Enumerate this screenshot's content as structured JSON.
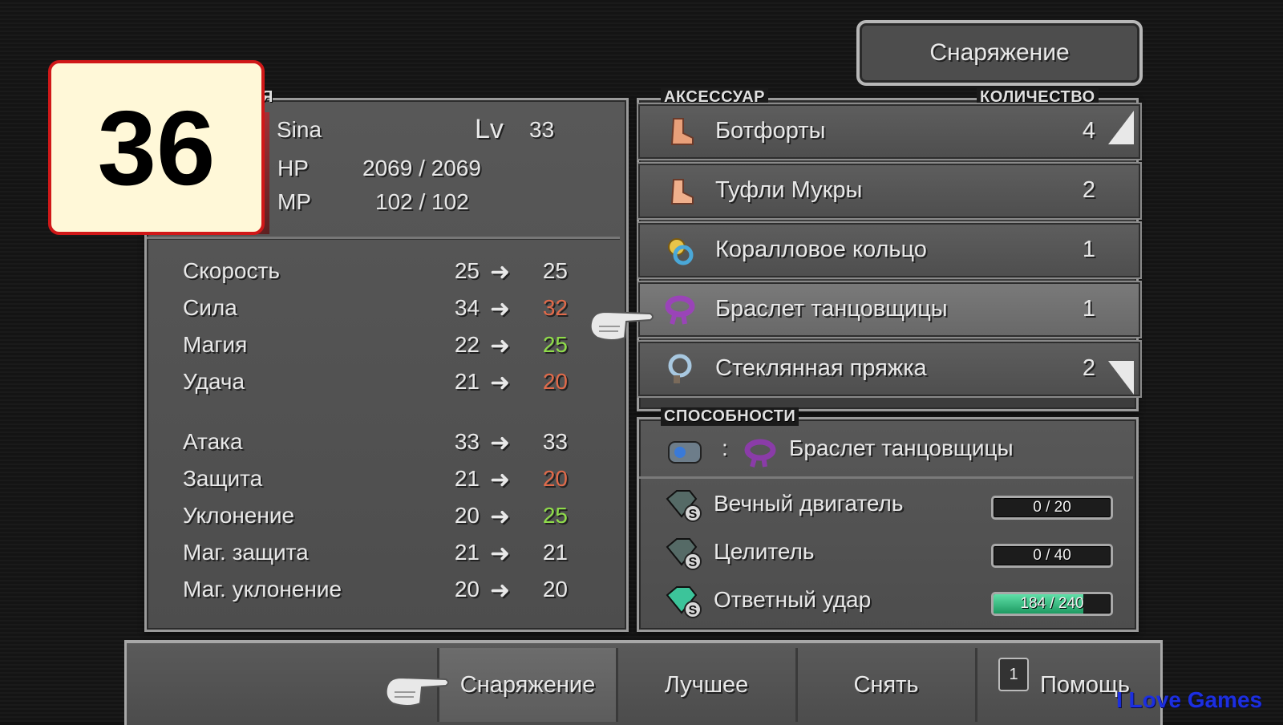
{
  "menu_title": "Снаряжение",
  "episode_badge": "36",
  "character": {
    "name": "Sina",
    "lv_label": "Lv",
    "level": "33",
    "hp_label": "HP",
    "hp": "2069 / 2069",
    "mp_label": "MP",
    "mp": "102 / 102",
    "section_label_fragment": "Я"
  },
  "stats": [
    {
      "label": "Скорость",
      "current": "25",
      "new": "25",
      "new_color": "#e8e8e8"
    },
    {
      "label": "Сила",
      "current": "34",
      "new": "32",
      "new_color": "#e06a4a"
    },
    {
      "label": "Магия",
      "current": "22",
      "new": "25",
      "new_color": "#8fdc4a"
    },
    {
      "label": "Удача",
      "current": "21",
      "new": "20",
      "new_color": "#e06a4a"
    },
    {
      "label": "Атака",
      "current": "33",
      "new": "33",
      "new_color": "#e8e8e8"
    },
    {
      "label": "Защита",
      "current": "21",
      "new": "20",
      "new_color": "#e06a4a"
    },
    {
      "label": "Уклонение",
      "current": "20",
      "new": "25",
      "new_color": "#8fdc4a"
    },
    {
      "label": "Маг. защита",
      "current": "21",
      "new": "21",
      "new_color": "#e8e8e8"
    },
    {
      "label": "Маг. уклонение",
      "current": "20",
      "new": "20",
      "new_color": "#e8e8e8"
    }
  ],
  "accessory_header": "АКСЕССУАР",
  "quantity_header": "КОЛИЧЕСТВО",
  "items": [
    {
      "name": "Ботфорты",
      "qty": "4",
      "icon": "boot-icon"
    },
    {
      "name": "Туфли Мукры",
      "qty": "2",
      "icon": "shoe-icon"
    },
    {
      "name": "Коралловое кольцо",
      "qty": "1",
      "icon": "ring-icon"
    },
    {
      "name": "Браслет танцовщицы",
      "qty": "1",
      "icon": "bracelet-icon"
    },
    {
      "name": "Стеклянная пряжка",
      "qty": "2",
      "icon": "buckle-icon"
    }
  ],
  "abilities_header": "СПОСОБНОСТИ",
  "ability_source": {
    "colon": ":",
    "item": "Браслет танцовщицы"
  },
  "abilities": [
    {
      "name": "Вечный двигатель",
      "ap": "0 / 20",
      "progress": 0.0
    },
    {
      "name": "Целитель",
      "ap": "0 / 40",
      "progress": 0.0
    },
    {
      "name": "Ответный удар",
      "ap": "184 / 240",
      "progress": 0.77
    }
  ],
  "commands": [
    {
      "label": "Снаряжение"
    },
    {
      "label": "Лучшее"
    },
    {
      "label": "Снять"
    },
    {
      "label": "Помощь",
      "key": "1"
    }
  ],
  "watermark": "I Love Games"
}
